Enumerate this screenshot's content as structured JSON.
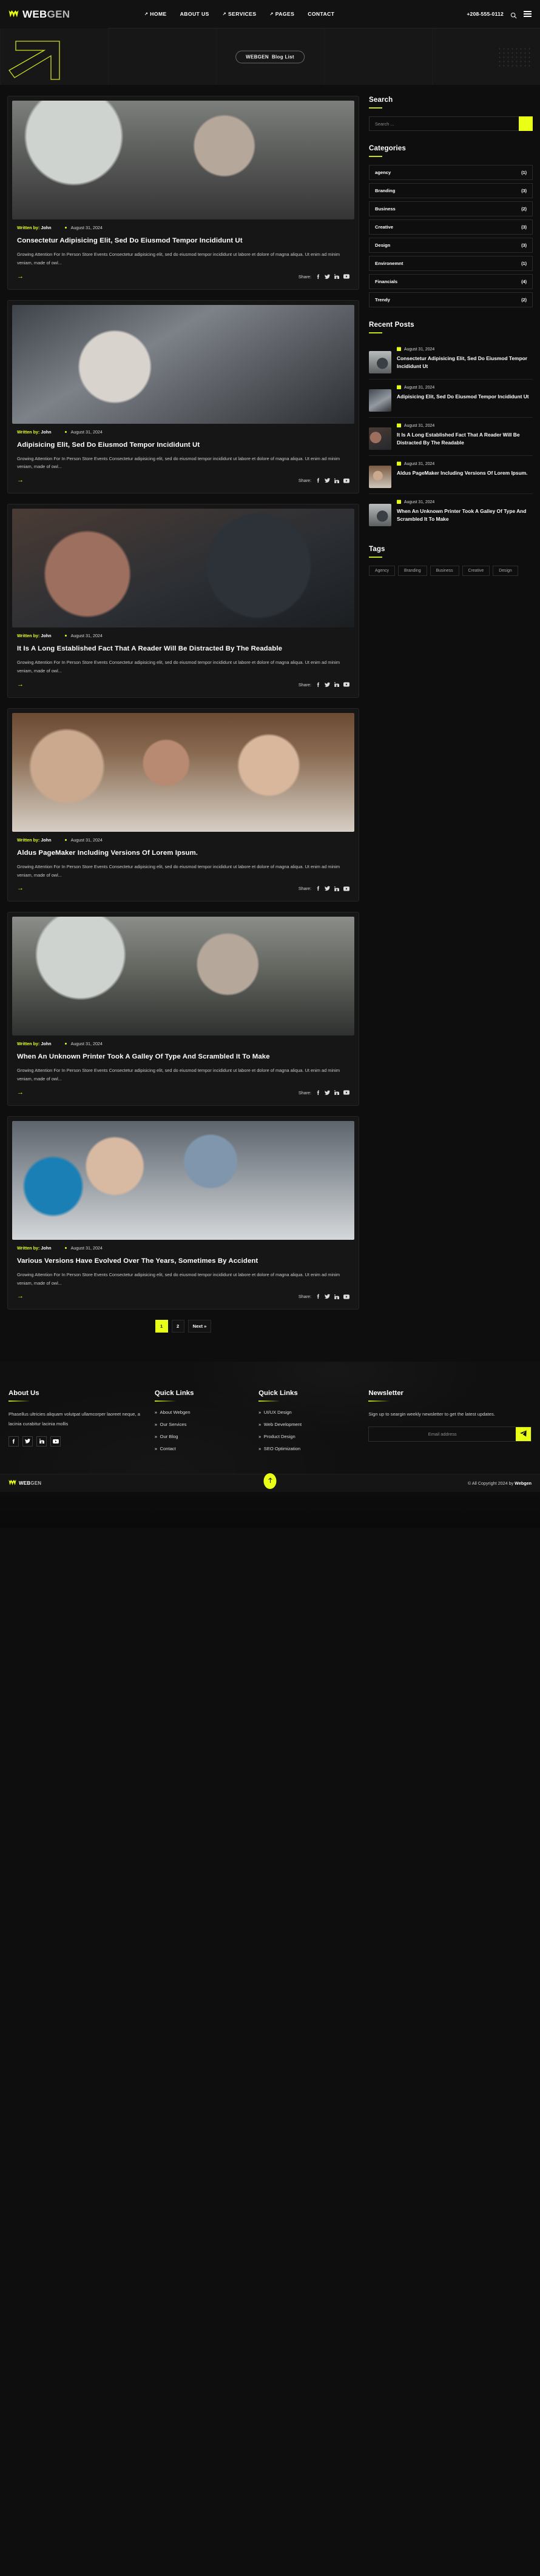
{
  "brand": {
    "name_bold": "WEB",
    "name_light": "GEN",
    "logo_icon": "w-crown-logo"
  },
  "header": {
    "nav": [
      {
        "label": "HOME",
        "arrow": true
      },
      {
        "label": "ABOUT US",
        "arrow": false
      },
      {
        "label": "SERVICES",
        "arrow": true
      },
      {
        "label": "PAGES",
        "arrow": true
      },
      {
        "label": "CONTACT",
        "arrow": false
      }
    ],
    "phone": "+208-555-0112",
    "search_icon": "search-icon",
    "menu_icon": "hamburger-icon"
  },
  "hero": {
    "breadcrumb_brand": "WEBGEN",
    "breadcrumb_page": "Blog List"
  },
  "search_widget": {
    "title": "Search",
    "placeholder": "Search ...",
    "value": "",
    "button_icon": "search-icon"
  },
  "categories_widget": {
    "title": "Categories",
    "items": [
      {
        "name": "agency",
        "count": "(1)"
      },
      {
        "name": "Branding",
        "count": "(3)"
      },
      {
        "name": "Business",
        "count": "(2)"
      },
      {
        "name": "Creative",
        "count": "(3)"
      },
      {
        "name": "Design",
        "count": "(3)"
      },
      {
        "name": "Environemnt",
        "count": "(1)"
      },
      {
        "name": "Financials",
        "count": "(4)"
      },
      {
        "name": "Trendy",
        "count": "(2)"
      }
    ]
  },
  "recent_posts_widget": {
    "title": "Recent Posts",
    "items": [
      {
        "date": "August 31, 2024",
        "title": "Consectetur Adipisicing Elit, Sed Do Eiusmod Tempor Incididunt Ut"
      },
      {
        "date": "August 31, 2024",
        "title": "Adipisicing Elit, Sed Do Eiusmod Tempor Incididunt Ut"
      },
      {
        "date": "August 31, 2024",
        "title": "It Is A Long Established Fact That A Reader Will Be Distracted By The Readable"
      },
      {
        "date": "August 31, 2024",
        "title": "Aldus PageMaker Including Versions Of Lorem Ipsum."
      },
      {
        "date": "August 31, 2024",
        "title": "When An Unknown Printer Took A Galley Of Type And Scrambled It To Make"
      }
    ]
  },
  "tags_widget": {
    "title": "Tags",
    "items": [
      "Agency",
      "Branding",
      "Business",
      "Creative",
      "Design"
    ]
  },
  "posts": {
    "author_label": "Written by:",
    "author_name": "John",
    "share_label": "Share:",
    "excerpt": "Growing Attention For In Person Store Events Consectetur adipisicing elit, sed do eiusmod tempor incididunt ut labore et dolore of magna aliqua. Ut enim ad minim veniam, made of owl...",
    "items": [
      {
        "date": "August 31, 2024",
        "title": "Consectetur Adipisicing Elit, Sed Do Eiusmod Tempor Incididunt Ut"
      },
      {
        "date": "August 31, 2024",
        "title": "Adipisicing Elit, Sed Do Eiusmod Tempor Incididunt Ut"
      },
      {
        "date": "August 31, 2024",
        "title": "It Is A Long Established Fact That A Reader Will Be Distracted By The Readable"
      },
      {
        "date": "August 31, 2024",
        "title": "Aldus PageMaker Including Versions Of Lorem Ipsum."
      },
      {
        "date": "August 31, 2024",
        "title": "When An Unknown Printer Took A Galley Of Type And Scrambled It To Make"
      },
      {
        "date": "August 31, 2024",
        "title": "Various Versions Have Evolved Over The Years, Sometimes By Accident"
      }
    ]
  },
  "pagination": {
    "pages": [
      "1",
      "2"
    ],
    "next_label": "Next »",
    "active": "1"
  },
  "footer": {
    "about": {
      "title": "About Us",
      "text": "Phasellus ultricies aliquam volutpat ullamcorper laoreet neque, a lacinia curabitur lacinia mollis",
      "social": [
        "facebook-icon",
        "twitter-icon",
        "linkedin-icon",
        "youtube-icon"
      ]
    },
    "quick_links_1": {
      "title": "Quick Links",
      "items": [
        "About Webgen",
        "Our Services",
        "Our Blog",
        "Contact"
      ]
    },
    "quick_links_2": {
      "title": "Quick Links",
      "items": [
        "UI/UX Design",
        "Web Development",
        "Product Design",
        "SEO Optimization"
      ]
    },
    "newsletter": {
      "title": "Newsletter",
      "text": "Sign up to seargin weekly newsletter to get the latest updates.",
      "placeholder": "Email address",
      "value": "",
      "button_icon": "send-icon"
    }
  },
  "copyright": {
    "text": "© All Copyright 2024 by ",
    "brand": "Webgen",
    "to_top_icon": "arrow-up-icon"
  },
  "colors": {
    "accent": "#e9ff15",
    "accent_rule": "#c7e01a",
    "bg": "#0e0e0e",
    "card": "#161616"
  }
}
